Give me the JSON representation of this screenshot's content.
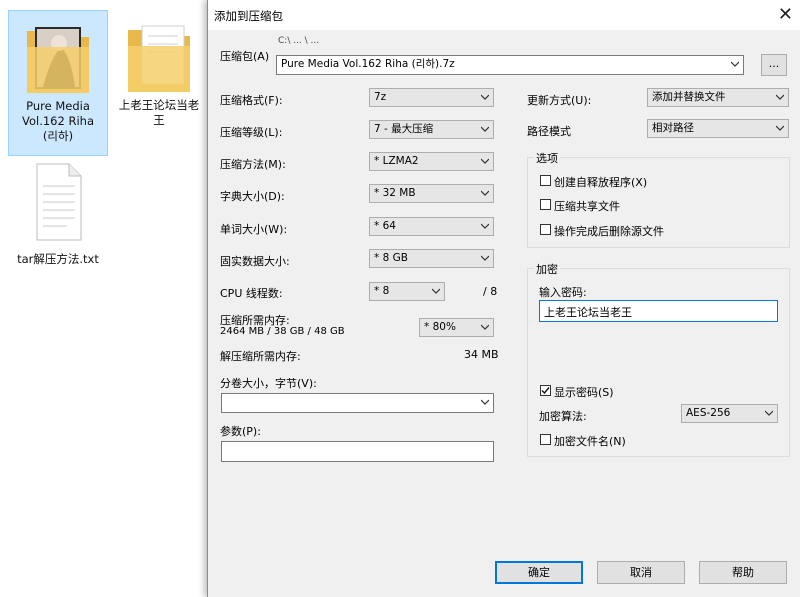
{
  "desktop": {
    "items": [
      {
        "name": "Pure Media Vol.162 Riha (리하)"
      },
      {
        "name": "上老王论坛当老王"
      },
      {
        "name": "tar解压方法.txt"
      }
    ]
  },
  "dialog": {
    "title": "添加到压缩包",
    "archive_label": "压缩包(A)",
    "archive_path_hint": "C:\\ ... \\ ...",
    "archive_value": "Pure Media Vol.162 Riha (리하).7z",
    "browse_label": "...",
    "format_label": "压缩格式(F):",
    "format_value": "7z",
    "level_label": "压缩等级(L):",
    "level_value": "7 - 最大压缩",
    "method_label": "压缩方法(M):",
    "method_value": "* LZMA2",
    "dict_label": "字典大小(D):",
    "dict_value": "* 32 MB",
    "word_label": "单词大小(W):",
    "word_value": "* 64",
    "solid_label": "固实数据大小:",
    "solid_value": "* 8 GB",
    "cpu_label": "CPU 线程数:",
    "cpu_value": "* 8",
    "cpu_total": "/ 8",
    "mem_label": "压缩所需内存:",
    "mem_detail": "2464 MB / 38 GB / 48 GB",
    "mem_value": "* 80%",
    "decomp_label": "解压缩所需内存:",
    "decomp_value": "34 MB",
    "volume_label": "分卷大小，字节(V):",
    "volume_value": "",
    "params_label": "参数(P):",
    "params_value": "",
    "update_label": "更新方式(U):",
    "update_value": "添加并替换文件",
    "path_label": "路径模式",
    "path_value": "相对路径",
    "options_title": "选项",
    "opt_sfx": "创建自释放程序(X)",
    "opt_shared": "压缩共享文件",
    "opt_delete": "操作完成后删除源文件",
    "enc_title": "加密",
    "enc_pwd_label": "输入密码:",
    "enc_pwd_value": "上老王论坛当老王",
    "enc_show_pwd": "显示密码(S)",
    "enc_method_label": "加密算法:",
    "enc_method_value": "AES-256",
    "enc_filenames": "加密文件名(N)",
    "ok_label": "确定",
    "cancel_label": "取消",
    "help_label": "帮助"
  }
}
